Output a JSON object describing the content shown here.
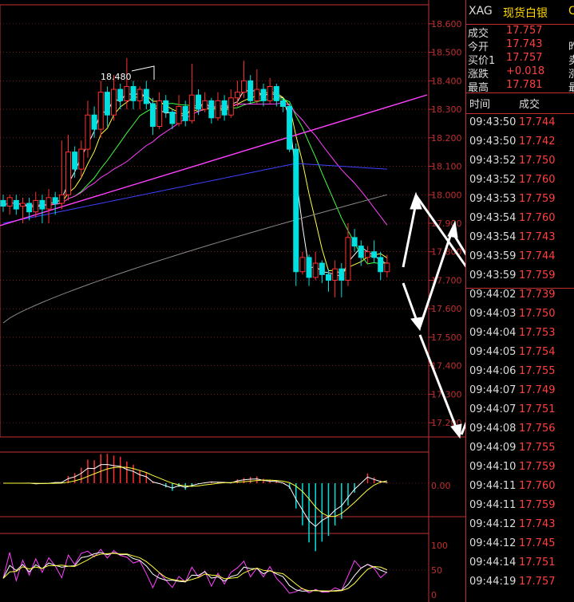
{
  "header": {
    "symbol": "XAG",
    "name": "现货白银",
    "extra": "C"
  },
  "quote": [
    {
      "label": "成交",
      "value": "17.757",
      "cut": ""
    },
    {
      "label": "今开",
      "value": "17.743",
      "cut": "昨"
    },
    {
      "label": "买价1",
      "value": "17.757",
      "cut": "卖"
    },
    {
      "label": "涨跌",
      "value": "+0.018",
      "cut": "涨"
    },
    {
      "label": "最高",
      "value": "17.781",
      "cut": "最"
    }
  ],
  "ticks_header": {
    "time": "时间",
    "price": "成交"
  },
  "ticks": [
    {
      "time": "09:43:50",
      "price": "17.744"
    },
    {
      "time": "09:43:50",
      "price": "17.742"
    },
    {
      "time": "09:43:52",
      "price": "17.750"
    },
    {
      "time": "09:43:52",
      "price": "17.760"
    },
    {
      "time": "09:43:53",
      "price": "17.759"
    },
    {
      "time": "09:43:54",
      "price": "17.760"
    },
    {
      "time": "09:43:54",
      "price": "17.743"
    },
    {
      "time": "09:43:59",
      "price": "17.744"
    },
    {
      "time": "09:43:59",
      "price": "17.759"
    },
    {
      "time": "09:44:02",
      "price": "17.739"
    },
    {
      "time": "09:44:03",
      "price": "17.750"
    },
    {
      "time": "09:44:04",
      "price": "17.753"
    },
    {
      "time": "09:44:05",
      "price": "17.754"
    },
    {
      "time": "09:44:06",
      "price": "17.755"
    },
    {
      "time": "09:44:07",
      "price": "17.749"
    },
    {
      "time": "09:44:07",
      "price": "17.751"
    },
    {
      "time": "09:44:08",
      "price": "17.756"
    },
    {
      "time": "09:44:09",
      "price": "17.755"
    },
    {
      "time": "09:44:10",
      "price": "17.759"
    },
    {
      "time": "09:44:11",
      "price": "17.760"
    },
    {
      "time": "09:44:11",
      "price": "17.759"
    },
    {
      "time": "09:44:12",
      "price": "17.743"
    },
    {
      "time": "09:44:12",
      "price": "17.745"
    },
    {
      "time": "09:44:14",
      "price": "17.751"
    },
    {
      "time": "09:44:19",
      "price": "17.757"
    }
  ],
  "chart_data": {
    "type": "candlestick",
    "price_axis": {
      "ticks": [
        "18.600",
        "18.500",
        "18.400",
        "18.300",
        "18.200",
        "18.100",
        "18.000",
        "17.900",
        "17.800",
        "17.700",
        "17.600",
        "17.500",
        "17.400",
        "17.300",
        "17.200"
      ],
      "range": [
        17.15,
        18.65
      ]
    },
    "max_label": "18.480",
    "candles": [
      [
        17.98,
        17.96,
        18.0,
        17.94
      ],
      [
        17.96,
        17.99,
        18.0,
        17.93
      ],
      [
        17.98,
        17.95,
        18.0,
        17.93
      ],
      [
        17.96,
        17.97,
        17.99,
        17.9
      ],
      [
        17.97,
        17.94,
        17.99,
        17.91
      ],
      [
        17.94,
        17.98,
        18.01,
        17.92
      ],
      [
        17.98,
        17.95,
        18.0,
        17.9
      ],
      [
        17.95,
        17.99,
        18.02,
        17.9
      ],
      [
        17.99,
        17.97,
        18.01,
        17.93
      ],
      [
        17.97,
        18.0,
        18.19,
        17.95
      ],
      [
        18.0,
        18.15,
        18.21,
        17.98
      ],
      [
        18.15,
        18.09,
        18.17,
        18.06
      ],
      [
        18.09,
        18.16,
        18.19,
        18.06
      ],
      [
        18.16,
        18.28,
        18.33,
        18.13
      ],
      [
        18.28,
        18.23,
        18.31,
        18.2
      ],
      [
        18.23,
        18.36,
        18.4,
        18.2
      ],
      [
        18.36,
        18.28,
        18.38,
        18.24
      ],
      [
        18.28,
        18.37,
        18.42,
        18.26
      ],
      [
        18.37,
        18.33,
        18.39,
        18.3
      ],
      [
        18.33,
        18.38,
        18.48,
        18.3
      ],
      [
        18.38,
        18.33,
        18.4,
        18.3
      ],
      [
        18.33,
        18.37,
        18.38,
        18.3
      ],
      [
        18.37,
        18.32,
        18.4,
        18.3
      ],
      [
        18.32,
        18.24,
        18.34,
        18.21
      ],
      [
        18.24,
        18.33,
        18.36,
        18.23
      ],
      [
        18.33,
        18.29,
        18.35,
        18.27
      ],
      [
        18.29,
        18.25,
        18.3,
        18.23
      ],
      [
        18.25,
        18.31,
        18.35,
        18.24
      ],
      [
        18.31,
        18.26,
        18.33,
        18.24
      ],
      [
        18.26,
        18.35,
        18.46,
        18.25
      ],
      [
        18.35,
        18.3,
        18.37,
        18.28
      ],
      [
        18.3,
        18.33,
        18.36,
        18.29
      ],
      [
        18.33,
        18.27,
        18.34,
        18.25
      ],
      [
        18.27,
        18.33,
        18.36,
        18.26
      ],
      [
        18.33,
        18.28,
        18.35,
        18.26
      ],
      [
        18.28,
        18.34,
        18.37,
        18.27
      ],
      [
        18.34,
        18.36,
        18.4,
        18.31
      ],
      [
        18.36,
        18.4,
        18.47,
        18.34
      ],
      [
        18.4,
        18.33,
        18.42,
        18.32
      ],
      [
        18.33,
        18.37,
        18.44,
        18.32
      ],
      [
        18.37,
        18.33,
        18.39,
        18.31
      ],
      [
        18.33,
        18.38,
        18.41,
        18.32
      ],
      [
        18.38,
        18.33,
        18.39,
        18.31
      ],
      [
        18.33,
        18.31,
        18.34,
        18.29
      ],
      [
        18.31,
        18.16,
        18.32,
        18.15
      ],
      [
        18.16,
        17.73,
        18.18,
        17.68
      ],
      [
        17.73,
        17.78,
        17.8,
        17.72
      ],
      [
        17.78,
        17.71,
        17.79,
        17.68
      ],
      [
        17.71,
        17.76,
        17.8,
        17.7
      ],
      [
        17.76,
        17.72,
        17.77,
        17.69
      ],
      [
        17.72,
        17.7,
        17.74,
        17.66
      ],
      [
        17.7,
        17.74,
        17.77,
        17.64
      ],
      [
        17.74,
        17.7,
        17.76,
        17.64
      ],
      [
        17.7,
        17.85,
        17.9,
        17.68
      ],
      [
        17.85,
        17.82,
        17.88,
        17.8
      ],
      [
        17.82,
        17.78,
        17.84,
        17.75
      ],
      [
        17.78,
        17.8,
        17.82,
        17.76
      ],
      [
        17.8,
        17.78,
        17.84,
        17.76
      ],
      [
        17.78,
        17.73,
        17.8,
        17.7
      ],
      [
        17.73,
        17.76,
        17.79,
        17.71
      ]
    ],
    "macd_axis": {
      "zero_label": "0.00"
    },
    "kdj_axis": {
      "ticks": [
        "100",
        "50",
        "0"
      ]
    }
  },
  "colors": {
    "up": "#ff3030",
    "down": "#00e0e0",
    "axis": "#c03030",
    "ma5": "#ffffff",
    "ma10": "#ffff40",
    "ma20": "#40ff40",
    "ma60": "#ff40ff",
    "ma120": "#4040ff",
    "ma250": "#888888",
    "trend": "#ff40ff"
  }
}
